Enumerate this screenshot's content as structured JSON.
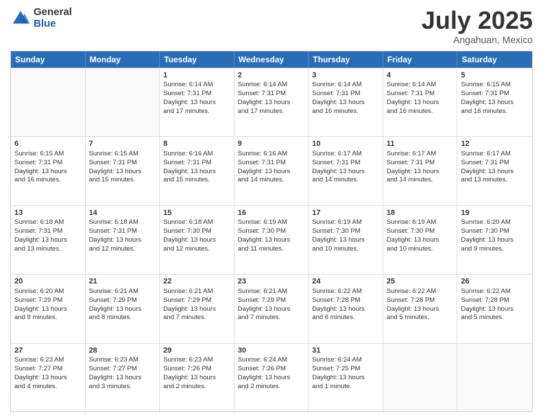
{
  "logo": {
    "general": "General",
    "blue": "Blue"
  },
  "title": "July 2025",
  "subtitle": "Angahuan, Mexico",
  "days": [
    "Sunday",
    "Monday",
    "Tuesday",
    "Wednesday",
    "Thursday",
    "Friday",
    "Saturday"
  ],
  "rows": [
    [
      {
        "day": "",
        "info": "",
        "empty": true
      },
      {
        "day": "",
        "info": "",
        "empty": true
      },
      {
        "day": "1",
        "info": "Sunrise: 6:14 AM\nSunset: 7:31 PM\nDaylight: 13 hours\nand 17 minutes."
      },
      {
        "day": "2",
        "info": "Sunrise: 6:14 AM\nSunset: 7:31 PM\nDaylight: 13 hours\nand 17 minutes."
      },
      {
        "day": "3",
        "info": "Sunrise: 6:14 AM\nSunset: 7:31 PM\nDaylight: 13 hours\nand 16 minutes."
      },
      {
        "day": "4",
        "info": "Sunrise: 6:14 AM\nSunset: 7:31 PM\nDaylight: 13 hours\nand 16 minutes."
      },
      {
        "day": "5",
        "info": "Sunrise: 6:15 AM\nSunset: 7:31 PM\nDaylight: 13 hours\nand 16 minutes."
      }
    ],
    [
      {
        "day": "6",
        "info": "Sunrise: 6:15 AM\nSunset: 7:31 PM\nDaylight: 13 hours\nand 16 minutes."
      },
      {
        "day": "7",
        "info": "Sunrise: 6:15 AM\nSunset: 7:31 PM\nDaylight: 13 hours\nand 15 minutes."
      },
      {
        "day": "8",
        "info": "Sunrise: 6:16 AM\nSunset: 7:31 PM\nDaylight: 13 hours\nand 15 minutes."
      },
      {
        "day": "9",
        "info": "Sunrise: 6:16 AM\nSunset: 7:31 PM\nDaylight: 13 hours\nand 14 minutes."
      },
      {
        "day": "10",
        "info": "Sunrise: 6:17 AM\nSunset: 7:31 PM\nDaylight: 13 hours\nand 14 minutes."
      },
      {
        "day": "11",
        "info": "Sunrise: 6:17 AM\nSunset: 7:31 PM\nDaylight: 13 hours\nand 14 minutes."
      },
      {
        "day": "12",
        "info": "Sunrise: 6:17 AM\nSunset: 7:31 PM\nDaylight: 13 hours\nand 13 minutes."
      }
    ],
    [
      {
        "day": "13",
        "info": "Sunrise: 6:18 AM\nSunset: 7:31 PM\nDaylight: 13 hours\nand 13 minutes."
      },
      {
        "day": "14",
        "info": "Sunrise: 6:18 AM\nSunset: 7:31 PM\nDaylight: 13 hours\nand 12 minutes."
      },
      {
        "day": "15",
        "info": "Sunrise: 6:18 AM\nSunset: 7:30 PM\nDaylight: 13 hours\nand 12 minutes."
      },
      {
        "day": "16",
        "info": "Sunrise: 6:19 AM\nSunset: 7:30 PM\nDaylight: 13 hours\nand 11 minutes."
      },
      {
        "day": "17",
        "info": "Sunrise: 6:19 AM\nSunset: 7:30 PM\nDaylight: 13 hours\nand 10 minutes."
      },
      {
        "day": "18",
        "info": "Sunrise: 6:19 AM\nSunset: 7:30 PM\nDaylight: 13 hours\nand 10 minutes."
      },
      {
        "day": "19",
        "info": "Sunrise: 6:20 AM\nSunset: 7:30 PM\nDaylight: 13 hours\nand 9 minutes."
      }
    ],
    [
      {
        "day": "20",
        "info": "Sunrise: 6:20 AM\nSunset: 7:29 PM\nDaylight: 13 hours\nand 9 minutes."
      },
      {
        "day": "21",
        "info": "Sunrise: 6:21 AM\nSunset: 7:29 PM\nDaylight: 13 hours\nand 8 minutes."
      },
      {
        "day": "22",
        "info": "Sunrise: 6:21 AM\nSunset: 7:29 PM\nDaylight: 13 hours\nand 7 minutes."
      },
      {
        "day": "23",
        "info": "Sunrise: 6:21 AM\nSunset: 7:29 PM\nDaylight: 13 hours\nand 7 minutes."
      },
      {
        "day": "24",
        "info": "Sunrise: 6:22 AM\nSunset: 7:28 PM\nDaylight: 13 hours\nand 6 minutes."
      },
      {
        "day": "25",
        "info": "Sunrise: 6:22 AM\nSunset: 7:28 PM\nDaylight: 13 hours\nand 5 minutes."
      },
      {
        "day": "26",
        "info": "Sunrise: 6:22 AM\nSunset: 7:28 PM\nDaylight: 13 hours\nand 5 minutes."
      }
    ],
    [
      {
        "day": "27",
        "info": "Sunrise: 6:23 AM\nSunset: 7:27 PM\nDaylight: 13 hours\nand 4 minutes."
      },
      {
        "day": "28",
        "info": "Sunrise: 6:23 AM\nSunset: 7:27 PM\nDaylight: 13 hours\nand 3 minutes."
      },
      {
        "day": "29",
        "info": "Sunrise: 6:23 AM\nSunset: 7:26 PM\nDaylight: 13 hours\nand 2 minutes."
      },
      {
        "day": "30",
        "info": "Sunrise: 6:24 AM\nSunset: 7:26 PM\nDaylight: 13 hours\nand 2 minutes."
      },
      {
        "day": "31",
        "info": "Sunrise: 6:24 AM\nSunset: 7:25 PM\nDaylight: 13 hours\nand 1 minute."
      },
      {
        "day": "",
        "info": "",
        "empty": true
      },
      {
        "day": "",
        "info": "",
        "empty": true
      }
    ]
  ]
}
